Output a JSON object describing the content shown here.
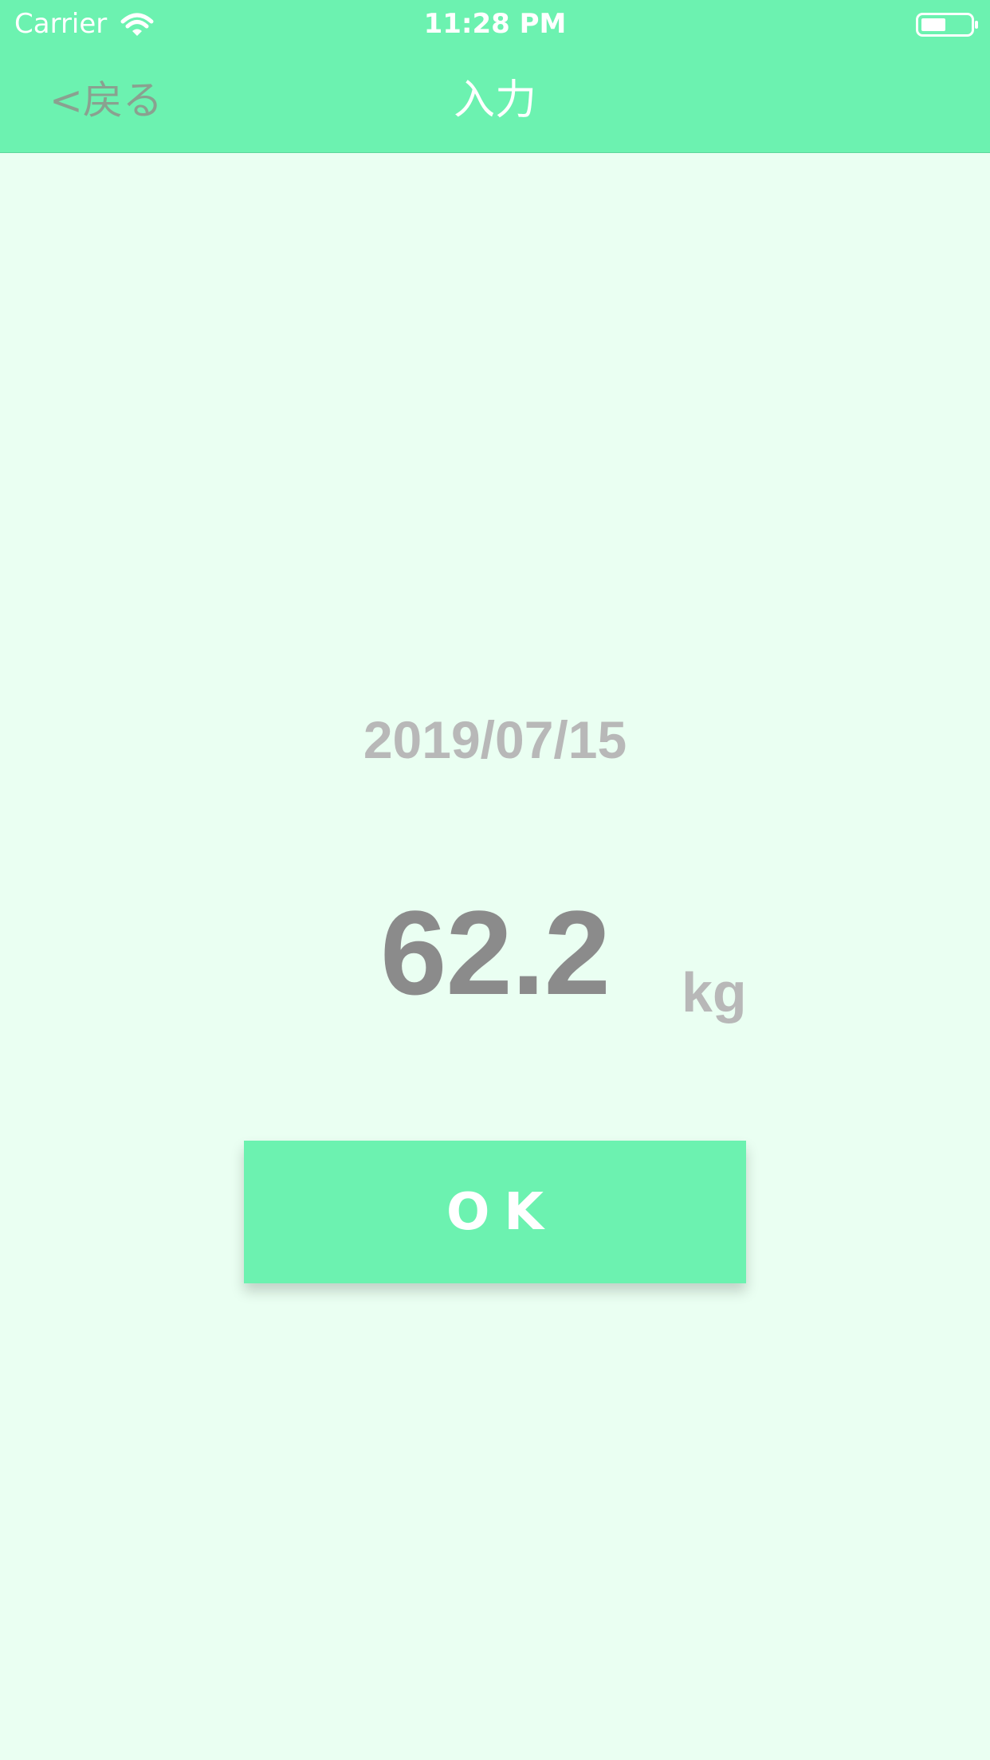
{
  "status_bar": {
    "carrier": "Carrier",
    "time": "11:28 PM",
    "wifi_icon": "wifi-icon",
    "battery_icon": "battery-icon"
  },
  "nav": {
    "back_label": "<戻る",
    "title": "入力"
  },
  "entry": {
    "date": "2019/07/15",
    "weight": "62.2",
    "unit": "kg"
  },
  "ok_button": {
    "label": "OK"
  },
  "colors": {
    "header_bg": "#6cf2b0",
    "page_bg": "#eafff2",
    "date_text": "#b8b8b8",
    "weight_text": "#8b8b8b",
    "back_text": "#8aa190"
  }
}
